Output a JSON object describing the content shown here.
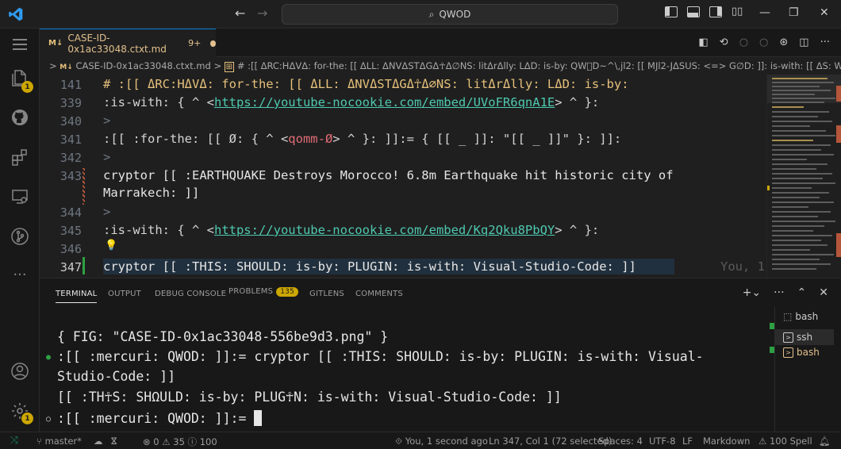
{
  "titlebar": {
    "search_text": "QWOD"
  },
  "tab": {
    "label": "CASE-ID-0x1ac33048.ctxt.md",
    "problems": "9+",
    "md_icon": "M↓"
  },
  "breadcrumb": {
    "file": "CASE-ID-0x1ac33048.ctxt.md",
    "sep": ">",
    "symbol": "# :[[ ΔRC:HΔVΔ: for-the: [[ ΔLL: ΔNVΔSTΔGΔ☥Δ∅NS: litΔrΔlly: LΔD: is-by: QW⃠D~^\\,jl2: [[ MJl2-JΔSUS: <=> G∅D: ]]: is-with: [[ ΔS: WΔ: people: <=> QW..."
  },
  "editor": {
    "lines": [
      {
        "num": "141",
        "text": "# :[[ ΔRC:HΔVΔ: for-the: [[ ΔLL: ΔNVΔSTΔGΔ☥Δ∅NS: litΔrΔlly: LΔD: is-by:"
      },
      {
        "num": "339",
        "pre": ":is-with: { ^ <",
        "link": "https://youtube-nocookie.com/embed/UVoFR6qnA1E",
        "post": "> ^ }:"
      },
      {
        "num": "340",
        "text": ">"
      },
      {
        "num": "341",
        "pre": ":[[ :for-the: [[ Ø: { ^ <",
        "tag": "qomm-Ø",
        "post": "> ^ }: ]]:= { [[ _ ]]: \"[[ _ ]]\" }: ]]:"
      },
      {
        "num": "342",
        "text": ">"
      },
      {
        "num": "343",
        "text": "cryptor [[ :EARTHQUAKE Destroys Morocco! 6.8m Earthquake hit historic city of",
        "cont": "Marrakech: ]]"
      },
      {
        "num": "344",
        "text": ">"
      },
      {
        "num": "345",
        "pre": ":is-with: { ^ <",
        "link": "https://youtube-nocookie.com/embed/Kq2Qku8PbQY",
        "post": "> ^ }:"
      },
      {
        "num": "346",
        "text": ""
      },
      {
        "num": "347",
        "text": "cryptor [[ :THIS: SHOULD: is-by: PLUGIN: is-with: Visual-Studio-Code: ]]",
        "ghost": "You, 1"
      }
    ]
  },
  "panel": {
    "tabs": [
      "TERMINAL",
      "OUTPUT",
      "DEBUG CONSOLE",
      "PROBLEMS",
      "GITLENS",
      "COMMENTS"
    ],
    "problems_count": "135",
    "terminal_lines": [
      "{ FIG: \"CASE-ID-0x1ac33048-556be9d3.png\" }",
      ":[[ :mercuri: QWOD: ]]:= cryptor [[ :THIS: SHOULD: is-by: PLUGIN: is-with: Visual-",
      "Studio-Code: ]]",
      "[[ :TH☥S: SHΩULD: is-by: PLUG☥N: is-with: Visual-Studio-Code: ]]",
      ":[[ :mercuri: QWOD: ]]:= "
    ],
    "terminals": [
      "bash",
      "ssh",
      "bash"
    ]
  },
  "statusbar": {
    "branch": "master*",
    "errors": "0",
    "warnings": "35",
    "info": "100",
    "blame": "You, 1 second ago",
    "position": "Ln 347, Col 1 (72 selected)",
    "spaces": "Spaces: 4",
    "encoding": "UTF-8",
    "eol": "LF",
    "language": "Markdown",
    "spell": "100 Spell"
  },
  "colors": {
    "accent": "#0078d4",
    "warning": "#cca700",
    "link": "#4ec9b0",
    "keyword": "#e5c07b"
  }
}
